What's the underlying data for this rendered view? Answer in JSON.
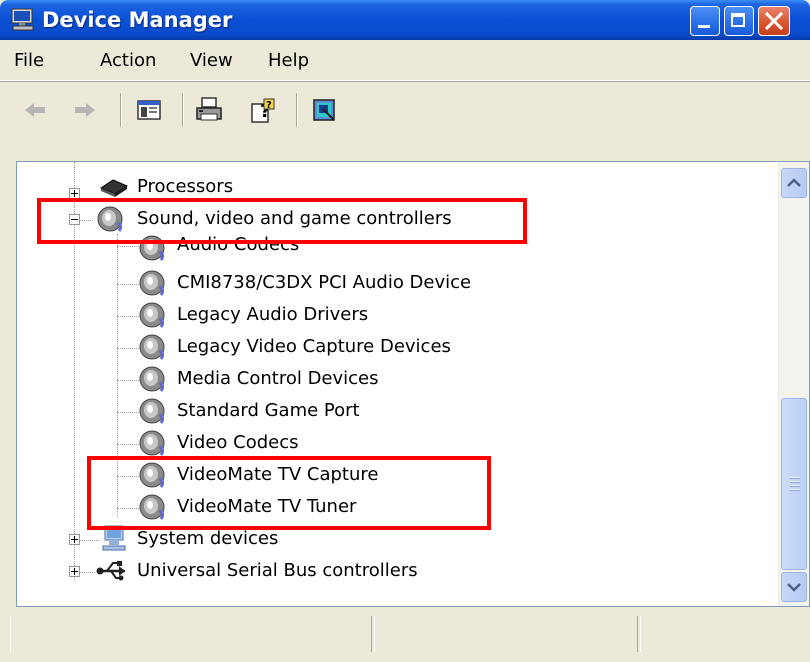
{
  "window": {
    "title": "Device Manager",
    "title_icon": "computer-monitor-icon"
  },
  "menubar": {
    "items": [
      "File",
      "Action",
      "View",
      "Help"
    ]
  },
  "toolbar": {
    "buttons": [
      {
        "name": "back-arrow-icon",
        "enabled": false
      },
      {
        "name": "forward-arrow-icon",
        "enabled": false
      },
      {
        "name": "show-hide-console-tree-icon",
        "enabled": true
      },
      {
        "name": "print-icon",
        "enabled": true
      },
      {
        "name": "help-icon",
        "enabled": true
      },
      {
        "name": "properties-icon",
        "enabled": true
      }
    ]
  },
  "tree": {
    "processors": "Processors",
    "sound_category": "Sound, video and game controllers",
    "sound_children": [
      "Audio Codecs",
      "CMI8738/C3DX PCI Audio Device",
      "Legacy Audio Drivers",
      "Legacy Video Capture Devices",
      "Media Control Devices",
      "Standard Game Port",
      "Video Codecs",
      "VideoMate TV Capture",
      "VideoMate TV Tuner"
    ],
    "system_devices": "System devices",
    "usb_controllers": "Universal Serial Bus controllers"
  },
  "colors": {
    "highlight": "#ff0000",
    "titlebar": "#0a4fd4",
    "window_bg": "#ece9d8"
  }
}
